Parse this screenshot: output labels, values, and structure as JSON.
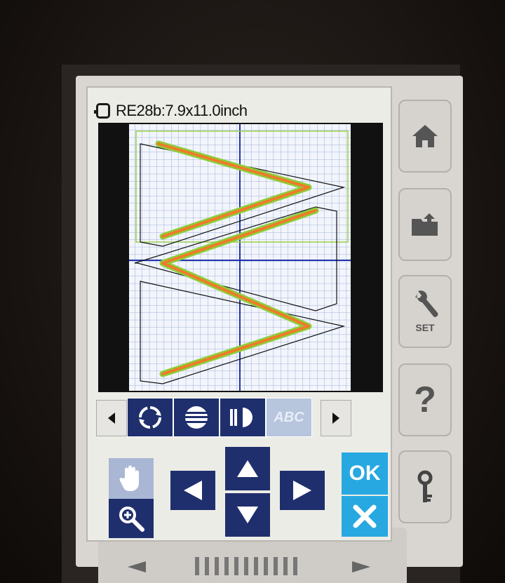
{
  "screen": {
    "title": "RE28b:7.9x11.0inch"
  },
  "toolbar": {
    "tools": [
      "rotate-tool",
      "flip-horizontal-tool",
      "flip-vertical-tool",
      "text-arc-tool"
    ],
    "disabled_tool_label": "ABC"
  },
  "actions": {
    "ok_label": "OK"
  },
  "side_buttons": {
    "set_label": "SET",
    "help_label": "?"
  },
  "colors": {
    "stitch_green": "#8ccf3a",
    "stitch_orange": "#f07a2a",
    "button_navy": "#1f2f6d",
    "button_cyan": "#27a8e0",
    "grid_blue": "#7b8fc9"
  }
}
